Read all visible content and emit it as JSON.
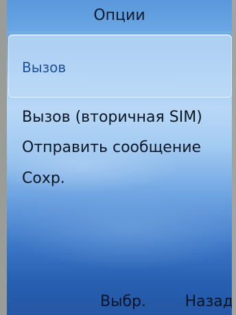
{
  "screen": {
    "title": "Опции",
    "menu": [
      {
        "label": "Вызов",
        "selected": true
      },
      {
        "label": "Вызов (вторичная SIM)",
        "selected": false
      },
      {
        "label": "Отправить сообщение",
        "selected": false
      },
      {
        "label": "Сохр.",
        "selected": false
      }
    ]
  },
  "softkeys": {
    "select": "Выбр.",
    "back": "Назад"
  },
  "colors": {
    "accent_selected_text": "#1e4f9a",
    "background_top": "#5b9ade",
    "background_bottom": "#2356a4"
  }
}
